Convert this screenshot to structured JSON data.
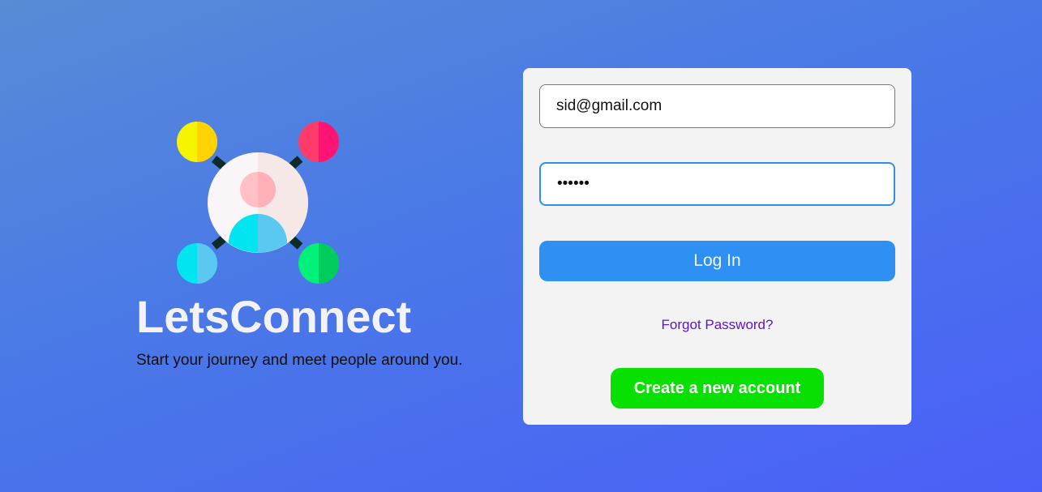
{
  "brand": {
    "title": "LetsConnect",
    "tagline": "Start your journey and meet people around you."
  },
  "login_form": {
    "email_value": "sid@gmail.com",
    "password_value": "••••••",
    "login_label": "Log In",
    "forgot_label": "Forgot Password?",
    "create_label": "Create a new account"
  },
  "colors": {
    "login_button": "#2f90f4",
    "create_button": "#07e000",
    "forgot_link": "#5a14d8",
    "focus_border": "#2d8fe8"
  }
}
